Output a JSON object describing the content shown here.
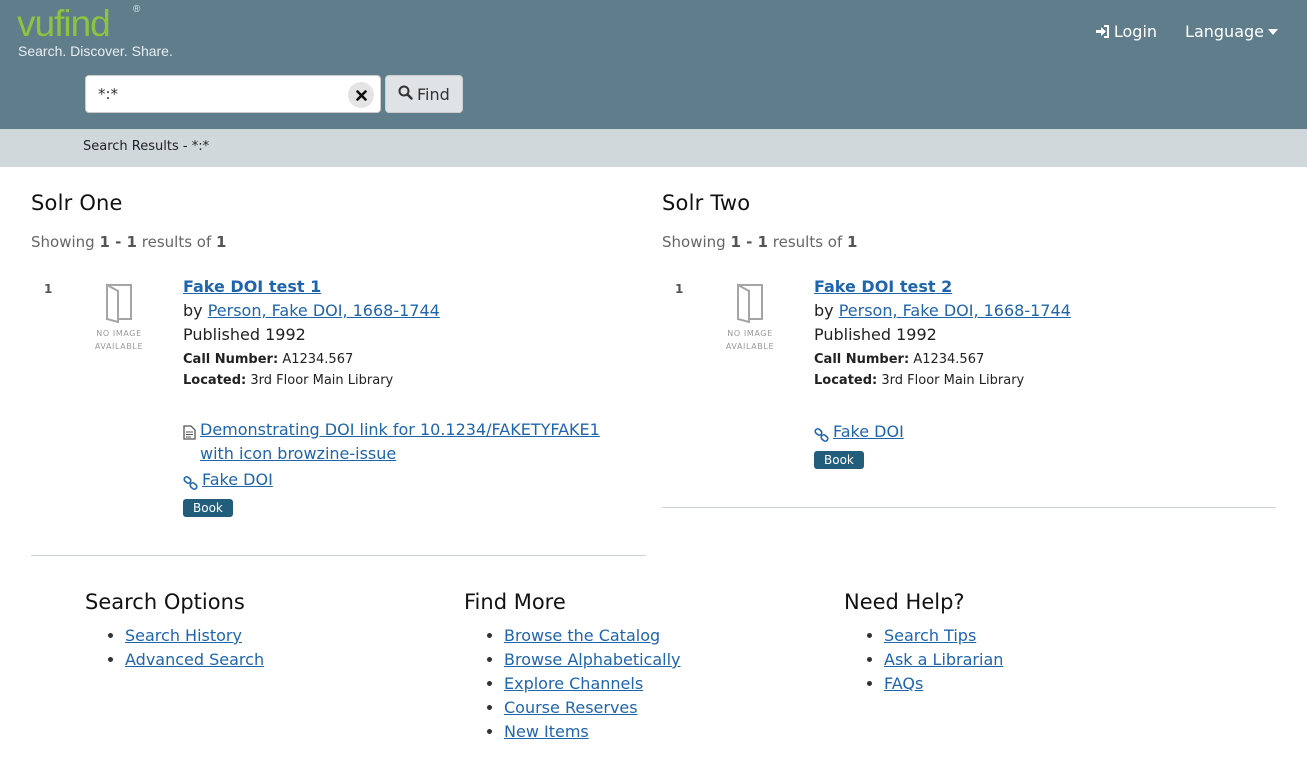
{
  "header": {
    "brand": "vufind",
    "registered": "®",
    "slogan": "Search. Discover. Share.",
    "login_label": "Login",
    "language_label": "Language"
  },
  "search": {
    "query": "*:*",
    "find_label": "Find"
  },
  "breadcrumb": "Search Results - *:*",
  "columns": [
    {
      "heading": "Solr One",
      "showing_prefix": "Showing",
      "range": "1 - 1",
      "results_of": "results of",
      "total": "1",
      "record": {
        "number": "1",
        "no_image_line1": "NO IMAGE",
        "no_image_line2": "AVAILABLE",
        "title": "Fake DOI test 1",
        "by": "by",
        "author": "Person, Fake DOI, 1668-1744",
        "published": "Published 1992",
        "call_number_label": "Call Number:",
        "call_number": "A1234.567",
        "located_label": "Located:",
        "located": "3rd Floor Main Library",
        "extra_link": "Demonstrating DOI link for 10.1234/FAKETYFAKE1 with icon browzine-issue",
        "doi_link": "Fake DOI",
        "format": "Book"
      }
    },
    {
      "heading": "Solr Two",
      "showing_prefix": "Showing",
      "range": "1 - 1",
      "results_of": "results of",
      "total": "1",
      "record": {
        "number": "1",
        "no_image_line1": "NO IMAGE",
        "no_image_line2": "AVAILABLE",
        "title": "Fake DOI test 2",
        "by": "by",
        "author": "Person, Fake DOI, 1668-1744",
        "published": "Published 1992",
        "call_number_label": "Call Number:",
        "call_number": "A1234.567",
        "located_label": "Located:",
        "located": "3rd Floor Main Library",
        "doi_link": "Fake DOI",
        "format": "Book"
      }
    }
  ],
  "footer": {
    "search_options": {
      "heading": "Search Options",
      "items": [
        "Search History",
        "Advanced Search"
      ]
    },
    "find_more": {
      "heading": "Find More",
      "items": [
        "Browse the Catalog",
        "Browse Alphabetically",
        "Explore Channels",
        "Course Reserves",
        "New Items"
      ]
    },
    "need_help": {
      "heading": "Need Help?",
      "items": [
        "Search Tips",
        "Ask a Librarian",
        "FAQs"
      ]
    }
  },
  "colors": {
    "header_bg": "#607d8b",
    "brand_green": "#8bc53f",
    "breadcrumb_bg": "#d1d8dc",
    "link": "#1f65ad",
    "badge_bg": "#225e7c"
  }
}
